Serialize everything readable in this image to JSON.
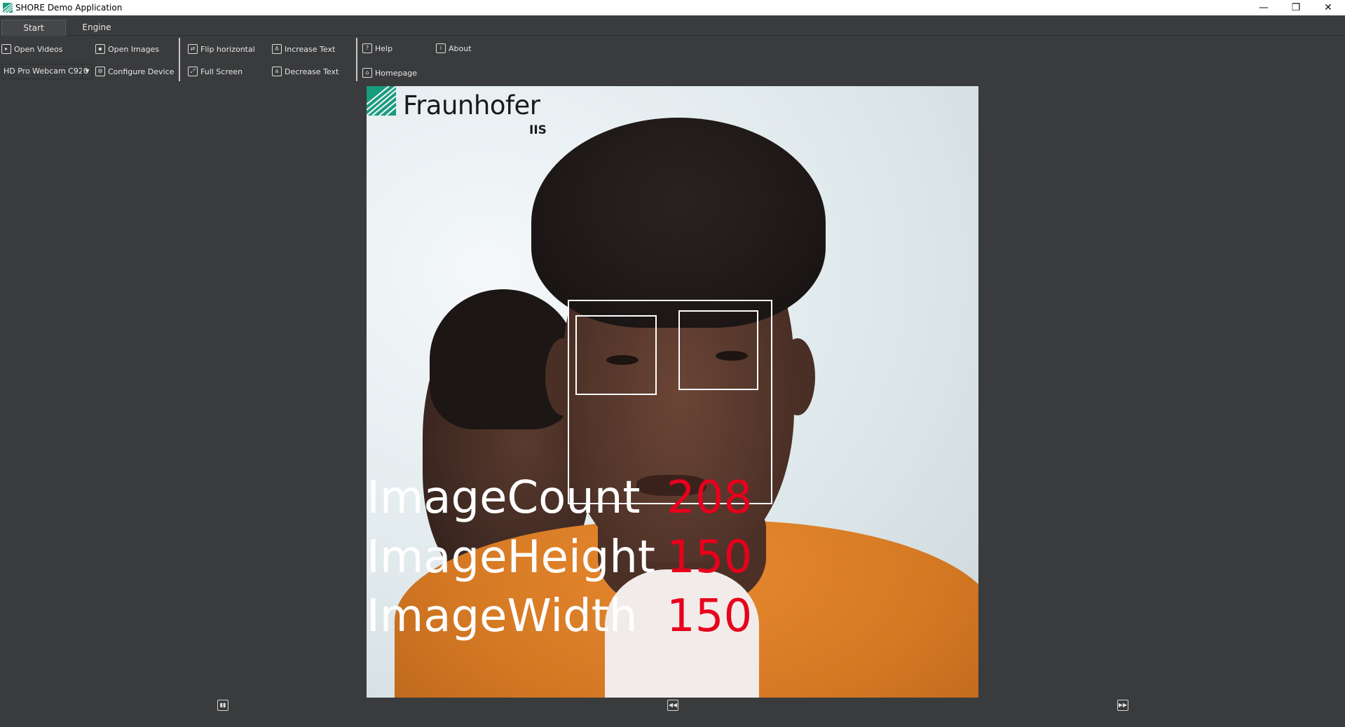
{
  "window": {
    "title": "SHORE Demo Application",
    "minimize": "—",
    "maximize": "❐",
    "close": "✕"
  },
  "tabs": [
    {
      "label": "Start",
      "active": true
    },
    {
      "label": "Engine",
      "active": false
    }
  ],
  "ribbon": {
    "open_videos": {
      "label": "Open Videos",
      "icon": "video-file-icon"
    },
    "open_images": {
      "label": "Open Images",
      "icon": "image-file-icon"
    },
    "device_select": {
      "value": "HD Pro Webcam C920"
    },
    "configure_device": {
      "label": "Configure Device",
      "icon": "settings-icon"
    },
    "flip_horizontal": {
      "label": "Flip horizontal",
      "icon": "flip-icon"
    },
    "full_screen": {
      "label": "Full Screen",
      "icon": "fullscreen-icon"
    },
    "increase_text": {
      "label": "Increase Text",
      "icon": "text-increase-icon"
    },
    "decrease_text": {
      "label": "Decrease Text",
      "icon": "text-decrease-icon"
    },
    "help": {
      "label": "Help",
      "icon": "help-icon"
    },
    "about": {
      "label": "About",
      "icon": "info-icon"
    },
    "homepage": {
      "label": "Homepage",
      "icon": "home-icon"
    }
  },
  "viewer": {
    "logo": {
      "name": "Fraunhofer",
      "sub": "IIS"
    },
    "stats": [
      {
        "label": "ImageCount",
        "value": "208"
      },
      {
        "label": "ImageHeight",
        "value": "150"
      },
      {
        "label": "ImageWidth",
        "value": "150"
      }
    ],
    "overlay_color": "#ffffff",
    "value_color": "#e8001c"
  },
  "playback": {
    "pause": {
      "icon": "pause-icon",
      "glyph": "▮▮"
    },
    "previous": {
      "icon": "previous-icon",
      "glyph": "◀◀"
    },
    "next": {
      "icon": "next-icon",
      "glyph": "▶▶"
    }
  },
  "colors": {
    "background": "#3a3b3d",
    "accent": "#179c7d"
  }
}
